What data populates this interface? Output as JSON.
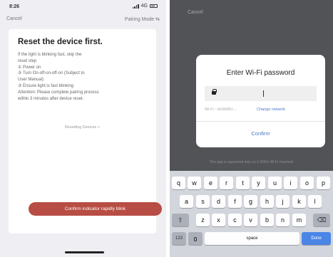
{
  "left_screen": {
    "time": "8:26",
    "signal": "4G",
    "cancel_label": "Cancel",
    "pairing_mode_label": "Pairing Mode",
    "title": "Reset the device first.",
    "instructions": [
      "If the light is blinking fast, skip the",
      "reset step",
      "① Power on",
      "② Turn On-off-on-off-on (Subject to",
      "User Manual)",
      "③ Ensure light is fast blinking",
      "Attention: Please complete pairing process",
      "within 3 minutes after device reset."
    ],
    "resetting_link": "Resetting Devices >",
    "confirm_button": "Confirm indicator rapidly blink",
    "colors": {
      "confirm_button": "#b74d44",
      "background": "#efeff3"
    }
  },
  "right_screen": {
    "cancel_label": "Cancel",
    "dialog": {
      "title": "Enter Wi-Fi password",
      "password_value": "",
      "wifi_label": "Wi-Fi : HUAWEI-...",
      "change_network": "Change network",
      "confirm": "Confirm"
    },
    "note": "This app is supported only on 2.4GHz Wi-Fi channels",
    "keyboard": {
      "row1": [
        "q",
        "w",
        "e",
        "r",
        "t",
        "y",
        "u",
        "i",
        "o",
        "p"
      ],
      "row2": [
        "a",
        "s",
        "d",
        "f",
        "g",
        "h",
        "j",
        "k",
        "l"
      ],
      "row3": [
        "z",
        "x",
        "c",
        "v",
        "b",
        "n",
        "m"
      ],
      "shift": "⇧",
      "backspace": "⌫",
      "numbers": "123",
      "space": "space",
      "done": "Done"
    },
    "colors": {
      "accent": "#4a78c9",
      "done_key": "#4b86e6",
      "overlay": "#525357"
    }
  }
}
